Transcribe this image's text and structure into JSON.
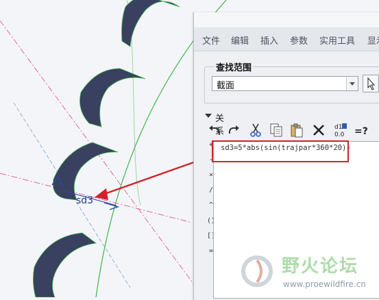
{
  "menu": [
    "文件",
    "编辑",
    "插入",
    "参数",
    "实用工具",
    "显示"
  ],
  "scope": {
    "label": "查找范围",
    "value": "截面"
  },
  "relations": {
    "label": "关系"
  },
  "toolbar_icons": [
    "undo-icon",
    "redo-icon",
    "cut-icon",
    "copy-icon",
    "paste-icon",
    "delete-icon",
    "parameter-value-icon",
    "evaluate-icon"
  ],
  "toolbar_text": {
    "param_top": "d1",
    "param_mid": "0.0",
    "evaluate": "=?"
  },
  "operators": [
    "+",
    "-",
    "×",
    "/",
    "^",
    "()",
    "[]",
    "="
  ],
  "editor": {
    "line1": "sd3=5*abs(sin(trajpar*360*20))"
  },
  "canvas": {
    "dimension": "sd3"
  },
  "watermark": {
    "name": "野火论坛",
    "url": "www.proewildfire.cn"
  },
  "colors": {
    "accent": "#d4202a",
    "curve": "#3bb54a",
    "ribbon": "#3a4060",
    "centerline": "#e0589a",
    "watermark": "#9fd69a"
  }
}
